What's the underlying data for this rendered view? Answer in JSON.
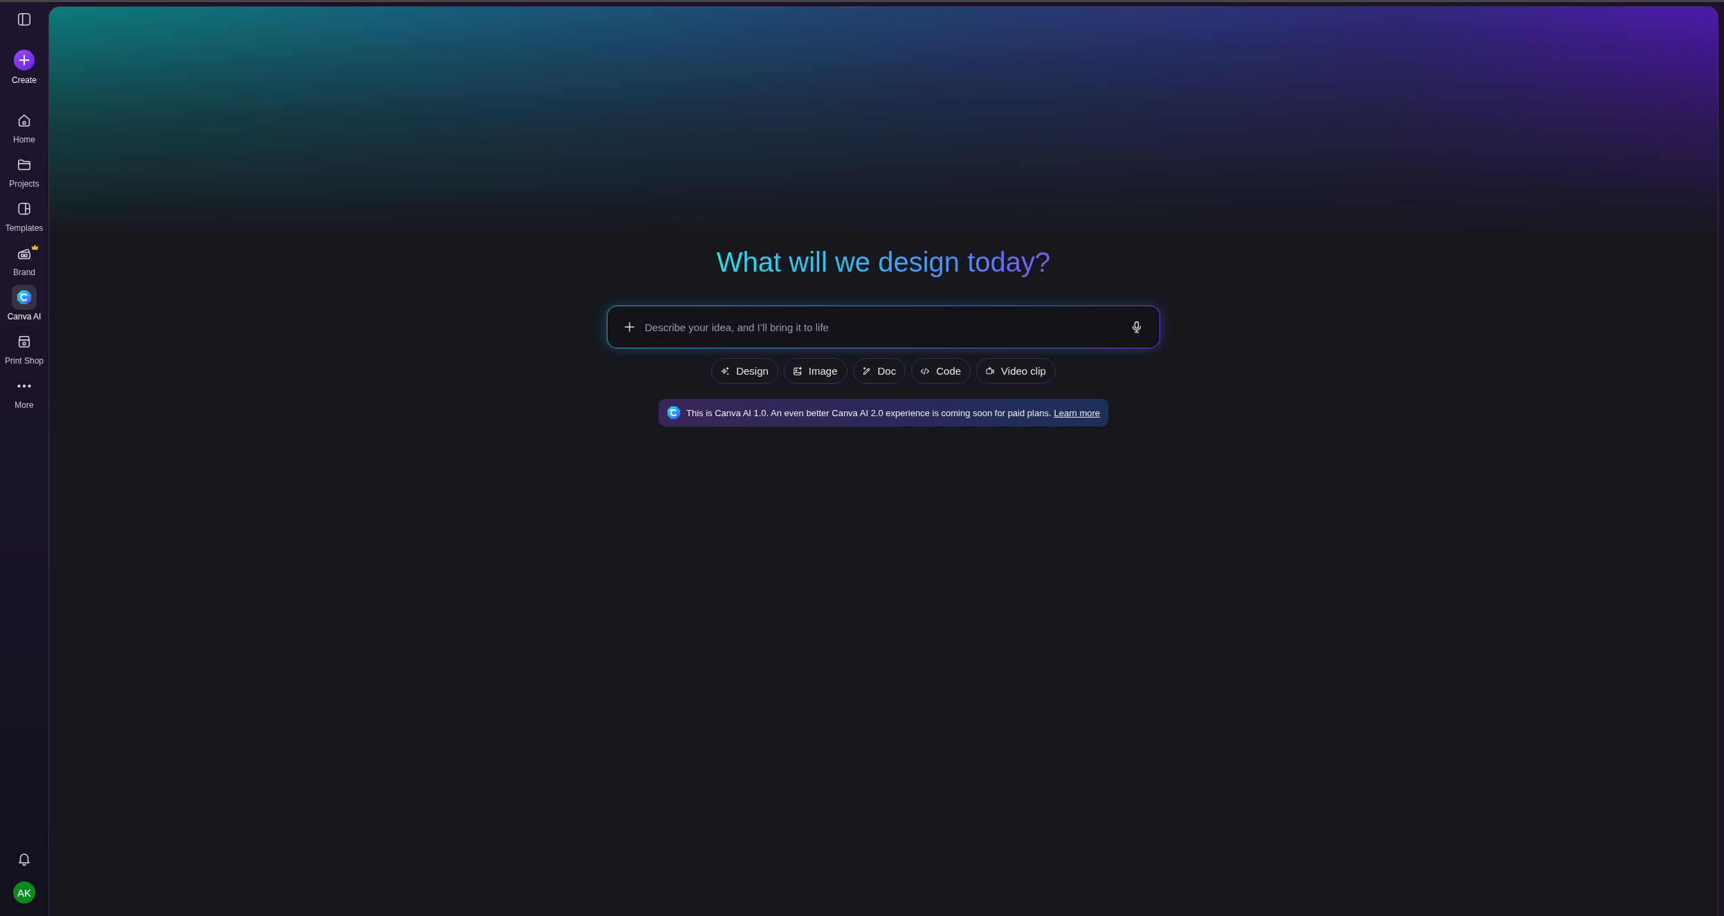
{
  "sidebar": {
    "create_button": {
      "label": "Create"
    },
    "nav_items": [
      {
        "label": "Home",
        "selected": false,
        "premium": false
      },
      {
        "label": "Projects",
        "selected": false,
        "premium": false
      },
      {
        "label": "Templates",
        "selected": false,
        "premium": false
      },
      {
        "label": "Brand",
        "selected": false,
        "premium": true
      },
      {
        "label": "Canva AI",
        "selected": true,
        "premium": false
      },
      {
        "label": "Print Shop",
        "selected": false,
        "premium": false
      },
      {
        "label": "More",
        "selected": false,
        "premium": false
      }
    ],
    "avatar": {
      "initials": "AK"
    }
  },
  "main": {
    "heading": "What will we design today?",
    "prompt": {
      "placeholder": "Describe your idea, and I’ll bring it to life"
    },
    "suggestions": [
      "Design",
      "Image",
      "Doc",
      "Code",
      "Video clip"
    ],
    "notice": {
      "text": "This is Canva AI 1.0. An even better Canva AI 2.0 experience is coming soon for paid plans.",
      "link": "Learn more"
    }
  }
}
